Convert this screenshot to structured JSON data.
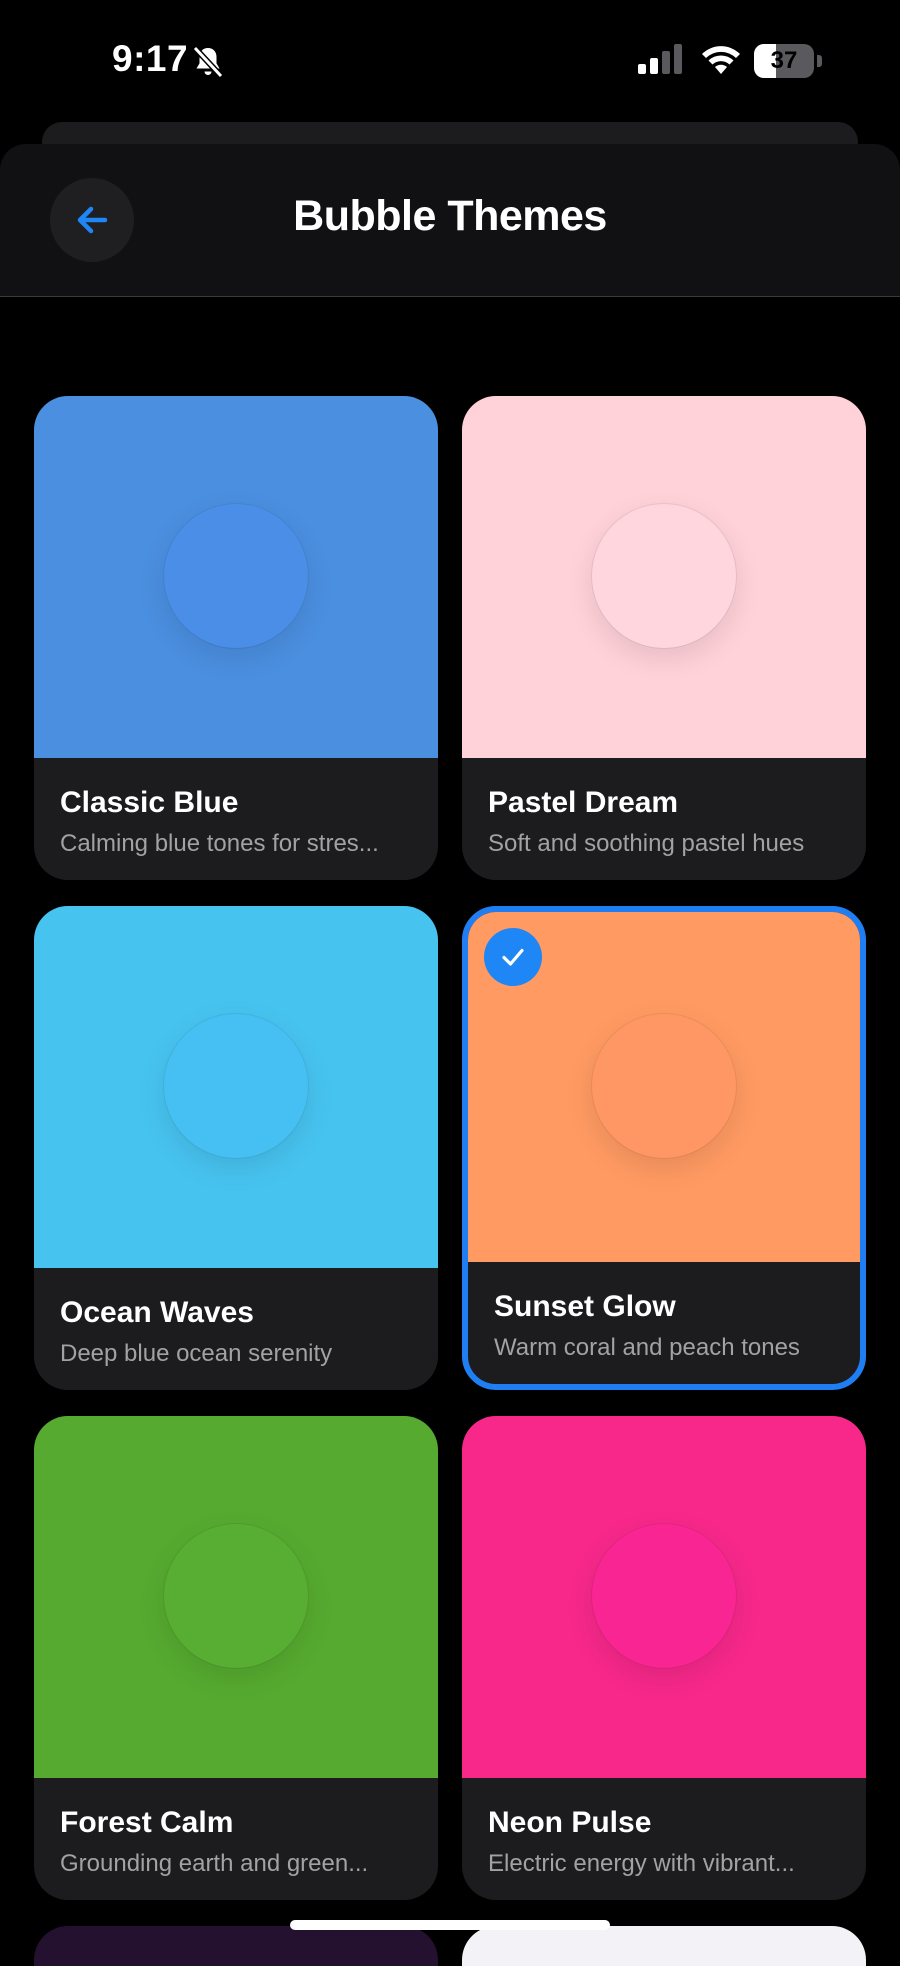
{
  "status_bar": {
    "time": "9:17",
    "battery": "37",
    "battery_level": 0.37
  },
  "header": {
    "title": "Bubble Themes"
  },
  "themes": [
    {
      "name": "Classic Blue",
      "description": "Calming blue tones for stres...",
      "color": "#4b8fe0",
      "bubble_color": "#4a8ee8",
      "selected": false
    },
    {
      "name": "Pastel Dream",
      "description": "Soft and soothing pastel hues",
      "color": "#ffd1d9",
      "bubble_color": "#ffd6de",
      "selected": false
    },
    {
      "name": "Ocean Waves",
      "description": "Deep blue ocean serenity",
      "color": "#47c3f0",
      "bubble_color": "#46c0f3",
      "selected": false
    },
    {
      "name": "Sunset Glow",
      "description": "Warm coral and peach tones",
      "color": "#ff9a62",
      "bubble_color": "#ff9765",
      "selected": true
    },
    {
      "name": "Forest Calm",
      "description": "Grounding earth and green...",
      "color": "#56aa30",
      "bubble_color": "#58ad33",
      "selected": false
    },
    {
      "name": "Neon Pulse",
      "description": "Electric energy with vibrant...",
      "color": "#f7288a",
      "bubble_color": "#f82593",
      "selected": false
    }
  ],
  "peek_colors": [
    "#24112f",
    "#f2f2f7"
  ]
}
